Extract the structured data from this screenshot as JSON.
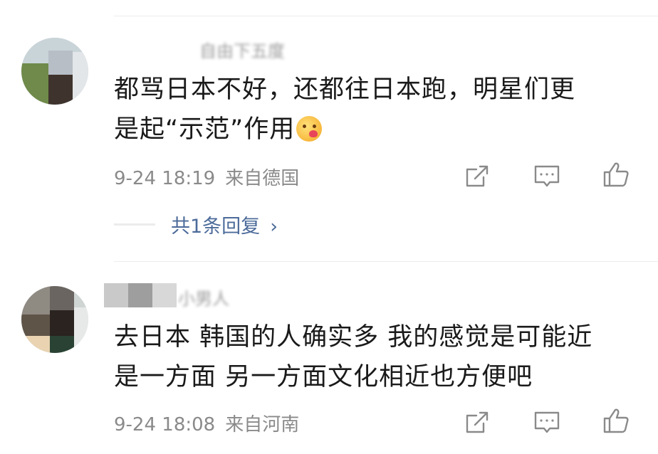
{
  "comments": [
    {
      "username": "自由下五度",
      "text_line1": "都骂日本不好，还都往日本跑，明星们更",
      "text_line2": "是起“示范”作用",
      "emoji": "yummy-face-emoji",
      "time": "9-24 18:19",
      "location": "来自德国",
      "replies_label": "共1条回复",
      "replies_chevron": "›"
    },
    {
      "username": "小男人",
      "text_line1": "去日本 韩国的人确实多 我的感觉是可能近",
      "text_line2": "是一方面 另一方面文化相近也方便吧",
      "time": "9-24 18:08",
      "location": "来自河南"
    }
  ],
  "icons": {
    "share": "share-icon",
    "comment": "comment-icon",
    "like": "thumbs-up-icon"
  },
  "colors": {
    "text": "#1a1a1a",
    "meta": "#8a8a8a",
    "reply_link": "#4c6b9a",
    "divider": "#ececec"
  }
}
